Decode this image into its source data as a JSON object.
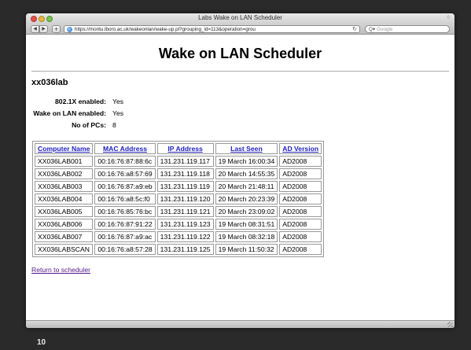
{
  "browser": {
    "title": "Labs Wake on LAN Scheduler",
    "url": "https://montu.lboro.ac.uk/wakeonlan/wake-up.pl?grouping_id=113&operation=grou",
    "search_placeholder": "Google",
    "icons": {
      "back": "back-arrow-icon",
      "forward": "forward-arrow-icon",
      "add": "plus-icon",
      "site": "globe-icon",
      "reload": "reload-icon",
      "search": "search-icon"
    }
  },
  "page": {
    "title": "Wake on LAN Scheduler",
    "lab_name": "xx036lab",
    "info": [
      {
        "label": "802.1X enabled:",
        "value": "Yes"
      },
      {
        "label": "Wake on LAN enabled:",
        "value": "Yes"
      },
      {
        "label": "No of PCs:",
        "value": "8"
      }
    ],
    "table": {
      "headers": [
        "Computer Name",
        "MAC Address",
        "IP Address",
        "Last Seen",
        "AD Version"
      ],
      "rows": [
        [
          "XX036LAB001",
          "00:16:76:87:88:6c",
          "131.231.119.117",
          "19 March 16:00:34",
          "AD2008"
        ],
        [
          "XX036LAB002",
          "00:16:76:a8:57:69",
          "131.231.119.118",
          "20 March 14:55:35",
          "AD2008"
        ],
        [
          "XX036LAB003",
          "00:16:76:87:a9:eb",
          "131.231.119.119",
          "20 March 21:48:11",
          "AD2008"
        ],
        [
          "XX036LAB004",
          "00:16:76:a8:5c:f0",
          "131.231.119.120",
          "20 March 20:23:39",
          "AD2008"
        ],
        [
          "XX036LAB005",
          "00:16:76:85:76:bc",
          "131.231.119.121",
          "20 March 23:09:02",
          "AD2008"
        ],
        [
          "XX036LAB006",
          "00:16:76:87:91:22",
          "131.231.119.123",
          "19 March 08:31:51",
          "AD2008"
        ],
        [
          "XX036LAB007",
          "00:16:76:87:a9:ac",
          "131.231.119.122",
          "19 March 08:32:18",
          "AD2008"
        ],
        [
          "XX036LABSCAN",
          "00:16:76:a8:57:28",
          "131.231.119.125",
          "19 March 11:50:32",
          "AD2008"
        ]
      ]
    },
    "return_link": "Return to scheduler"
  },
  "slide_number": "10",
  "colors": {
    "link": "#2020c0",
    "visited_link": "#551a8b",
    "slide_bg": "#2a2a2a"
  }
}
